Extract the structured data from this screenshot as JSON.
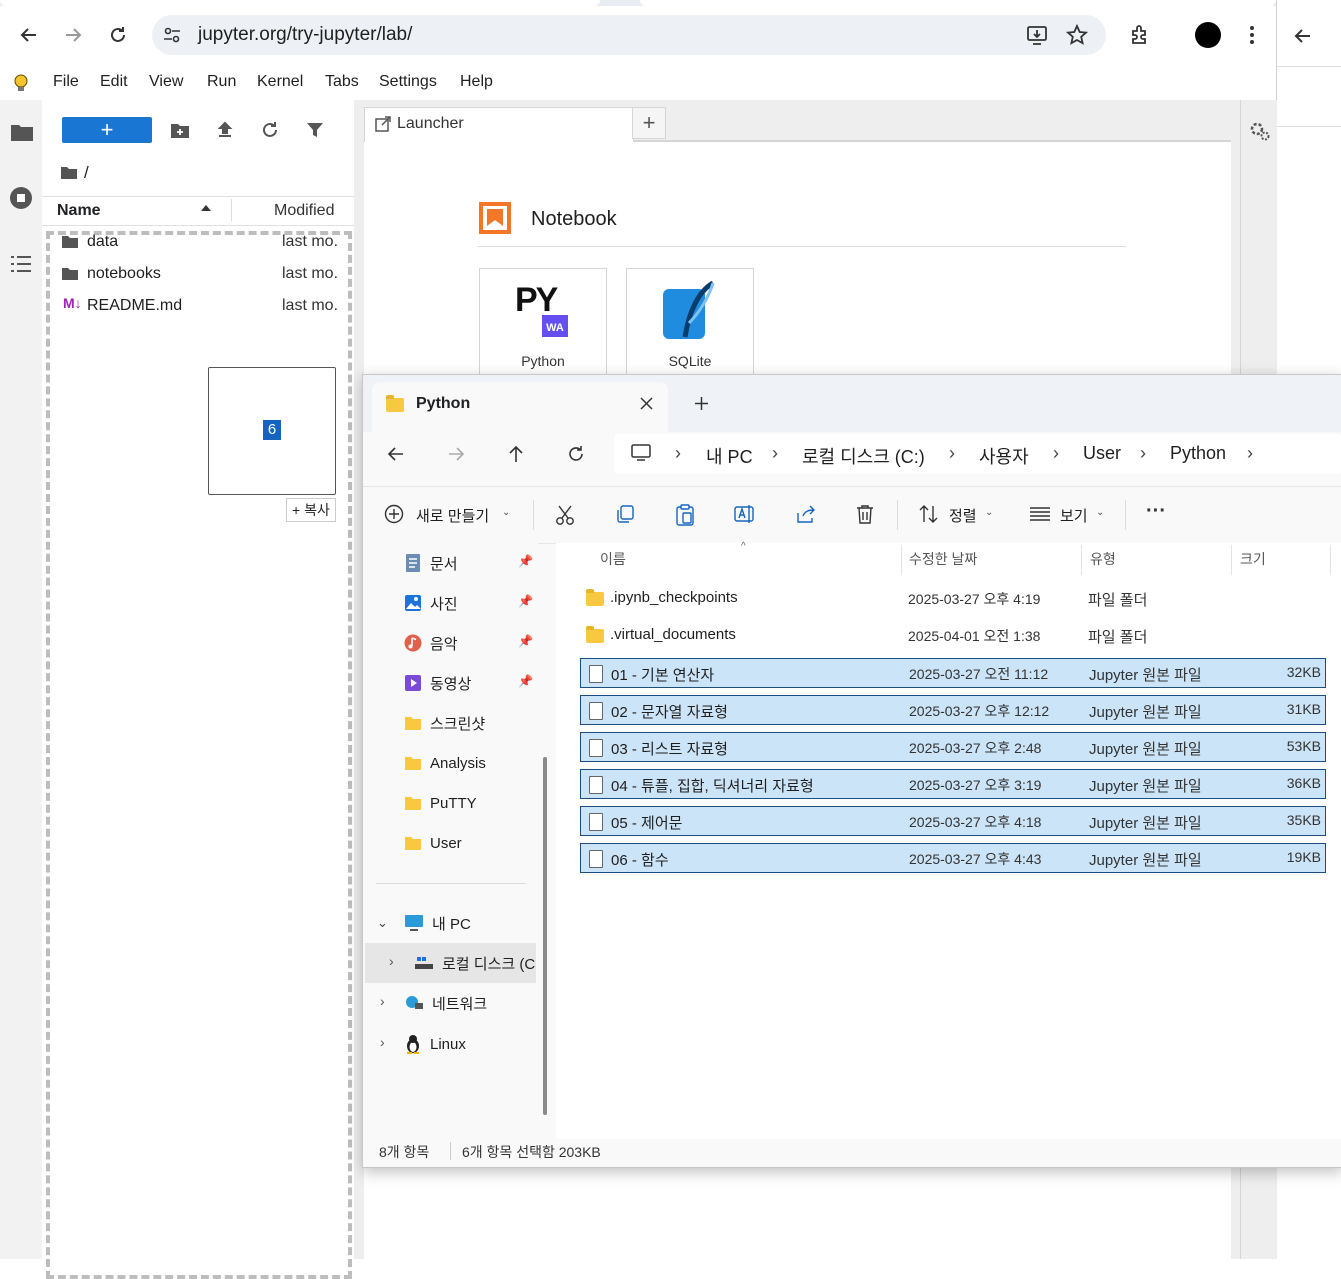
{
  "browser": {
    "url": "jupyter.org/try-jupyter/lab/",
    "icons": [
      "back-icon",
      "forward-icon",
      "reload-icon",
      "site-info-icon",
      "install-app-icon",
      "bookmark-star-icon",
      "extensions-icon",
      "profile-avatar",
      "more-menu-icon"
    ]
  },
  "jupyter": {
    "menu": [
      "File",
      "Edit",
      "View",
      "Run",
      "Kernel",
      "Tabs",
      "Settings",
      "Help"
    ],
    "new_button": "+",
    "breadcrumb": "/",
    "columns": {
      "name": "Name",
      "modified": "Modified"
    },
    "files": [
      {
        "name": "data",
        "modified": "last mo.",
        "kind": "folder"
      },
      {
        "name": "notebooks",
        "modified": "last mo.",
        "kind": "folder"
      },
      {
        "name": "README.md",
        "modified": "last mo.",
        "kind": "markdown"
      }
    ],
    "drag": {
      "count": "6",
      "copy_label": "+ 복사"
    },
    "launcher_tab": "Launcher",
    "add_tab": "+",
    "section_title": "Notebook",
    "kernels": [
      {
        "label": "Python",
        "logo_text": "PY",
        "badge": "WA"
      },
      {
        "label": "SQLite"
      }
    ]
  },
  "explorer": {
    "tab_title": "Python",
    "crumbs": [
      "내 PC",
      "로컬 디스크 (C:)",
      "사용자",
      "User",
      "Python"
    ],
    "toolbar": {
      "new": "새로 만들기",
      "sort": "정렬",
      "view": "보기",
      "more": "···"
    },
    "nav": [
      {
        "label": "문서",
        "icon": "documents-icon",
        "pinned": true
      },
      {
        "label": "사진",
        "icon": "pictures-icon",
        "pinned": true
      },
      {
        "label": "음악",
        "icon": "music-icon",
        "pinned": true
      },
      {
        "label": "동영상",
        "icon": "videos-icon",
        "pinned": true
      },
      {
        "label": "스크린샷",
        "icon": "folder-icon",
        "pinned": false
      },
      {
        "label": "Analysis",
        "icon": "folder-icon",
        "pinned": false
      },
      {
        "label": "PuTTY",
        "icon": "folder-icon",
        "pinned": false
      },
      {
        "label": "User",
        "icon": "folder-icon",
        "pinned": false
      }
    ],
    "tree": [
      {
        "label": "내 PC",
        "expanded": true
      },
      {
        "label": "로컬 디스크 (C",
        "expanded": false
      },
      {
        "label": "네트워크",
        "expanded": false
      },
      {
        "label": "Linux",
        "expanded": false
      }
    ],
    "columns": {
      "name": "이름",
      "modified": "수정한 날짜",
      "type": "유형",
      "size": "크기"
    },
    "rows": [
      {
        "name": ".ipynb_checkpoints",
        "modified": "2025-03-27 오후 4:19",
        "type": "파일 폴더",
        "size": "",
        "folder": true,
        "selected": false
      },
      {
        "name": ".virtual_documents",
        "modified": "2025-04-01 오전 1:38",
        "type": "파일 폴더",
        "size": "",
        "folder": true,
        "selected": false
      },
      {
        "name": "01 - 기본 연산자",
        "modified": "2025-03-27 오전 11:12",
        "type": "Jupyter 원본 파일",
        "size": "32KB",
        "folder": false,
        "selected": true
      },
      {
        "name": "02 - 문자열 자료형",
        "modified": "2025-03-27 오후 12:12",
        "type": "Jupyter 원본 파일",
        "size": "31KB",
        "folder": false,
        "selected": true
      },
      {
        "name": "03 - 리스트 자료형",
        "modified": "2025-03-27 오후 2:48",
        "type": "Jupyter 원본 파일",
        "size": "53KB",
        "folder": false,
        "selected": true
      },
      {
        "name": "04 - 튜플, 집합, 딕셔너리 자료형",
        "modified": "2025-03-27 오후 3:19",
        "type": "Jupyter 원본 파일",
        "size": "36KB",
        "folder": false,
        "selected": true
      },
      {
        "name": "05 - 제어문",
        "modified": "2025-03-27 오후 4:18",
        "type": "Jupyter 원본 파일",
        "size": "35KB",
        "folder": false,
        "selected": true
      },
      {
        "name": "06 - 함수",
        "modified": "2025-03-27 오후 4:43",
        "type": "Jupyter 원본 파일",
        "size": "19KB",
        "folder": false,
        "selected": true
      }
    ],
    "status": {
      "items": "8개 항목",
      "selected": "6개 항목 선택함 203KB"
    }
  }
}
